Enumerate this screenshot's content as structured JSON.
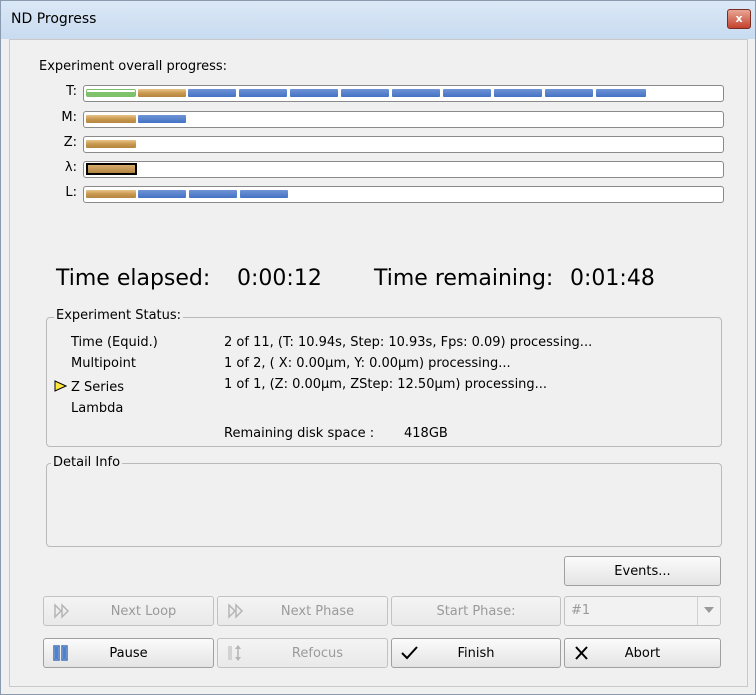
{
  "window": {
    "title": "ND Progress",
    "close_glyph": "x"
  },
  "progress": {
    "heading": "Experiment overall progress:",
    "rows": [
      {
        "label": "T:",
        "completed_loops": 2,
        "total_loops": 11
      },
      {
        "label": "M:",
        "completed_loops": 1,
        "total_loops": 2
      },
      {
        "label": "Z:",
        "completed_loops": 1,
        "total_loops": 1
      },
      {
        "label": "λ:",
        "completed_loops": 0,
        "total_loops": 1
      },
      {
        "label": "L:",
        "completed_loops": 1,
        "total_loops": 4
      }
    ]
  },
  "timing": {
    "elapsed_label": "Time elapsed:",
    "elapsed_value": "0:00:12",
    "remaining_label": "Time remaining:",
    "remaining_value": "0:01:48"
  },
  "status": {
    "title": "Experiment Status:",
    "items": [
      {
        "name": "Time (Equid.)",
        "detail": "2 of 11, (T: 10.94s, Step: 10.93s, Fps: 0.09) processing..."
      },
      {
        "name": "Multipoint",
        "detail": "1 of 2, ( X: 0.00µm, Y: 0.00µm) processing..."
      },
      {
        "name": "Z Series",
        "detail": "1 of 1, (Z: 0.00µm, ZStep: 12.50µm) processing..."
      },
      {
        "name": "Lambda",
        "detail": ""
      }
    ],
    "current_marker_icon": "arrow-right-icon",
    "disk_label": "Remaining disk space :",
    "disk_value": "418GB"
  },
  "detail": {
    "title": "Detail Info"
  },
  "buttons": {
    "events": "Events...",
    "next_loop": "Next Loop",
    "next_phase": "Next Phase",
    "start_phase": "Start Phase:",
    "phase_select_value": "#1",
    "pause": "Pause",
    "refocus": "Refocus",
    "finish": "Finish",
    "abort": "Abort"
  },
  "colors": {
    "done_segment": "#7ec26a",
    "current_segment": "#c9984e",
    "pending_segment": "#4472c4",
    "accent_blue": "#3b6fb8"
  }
}
